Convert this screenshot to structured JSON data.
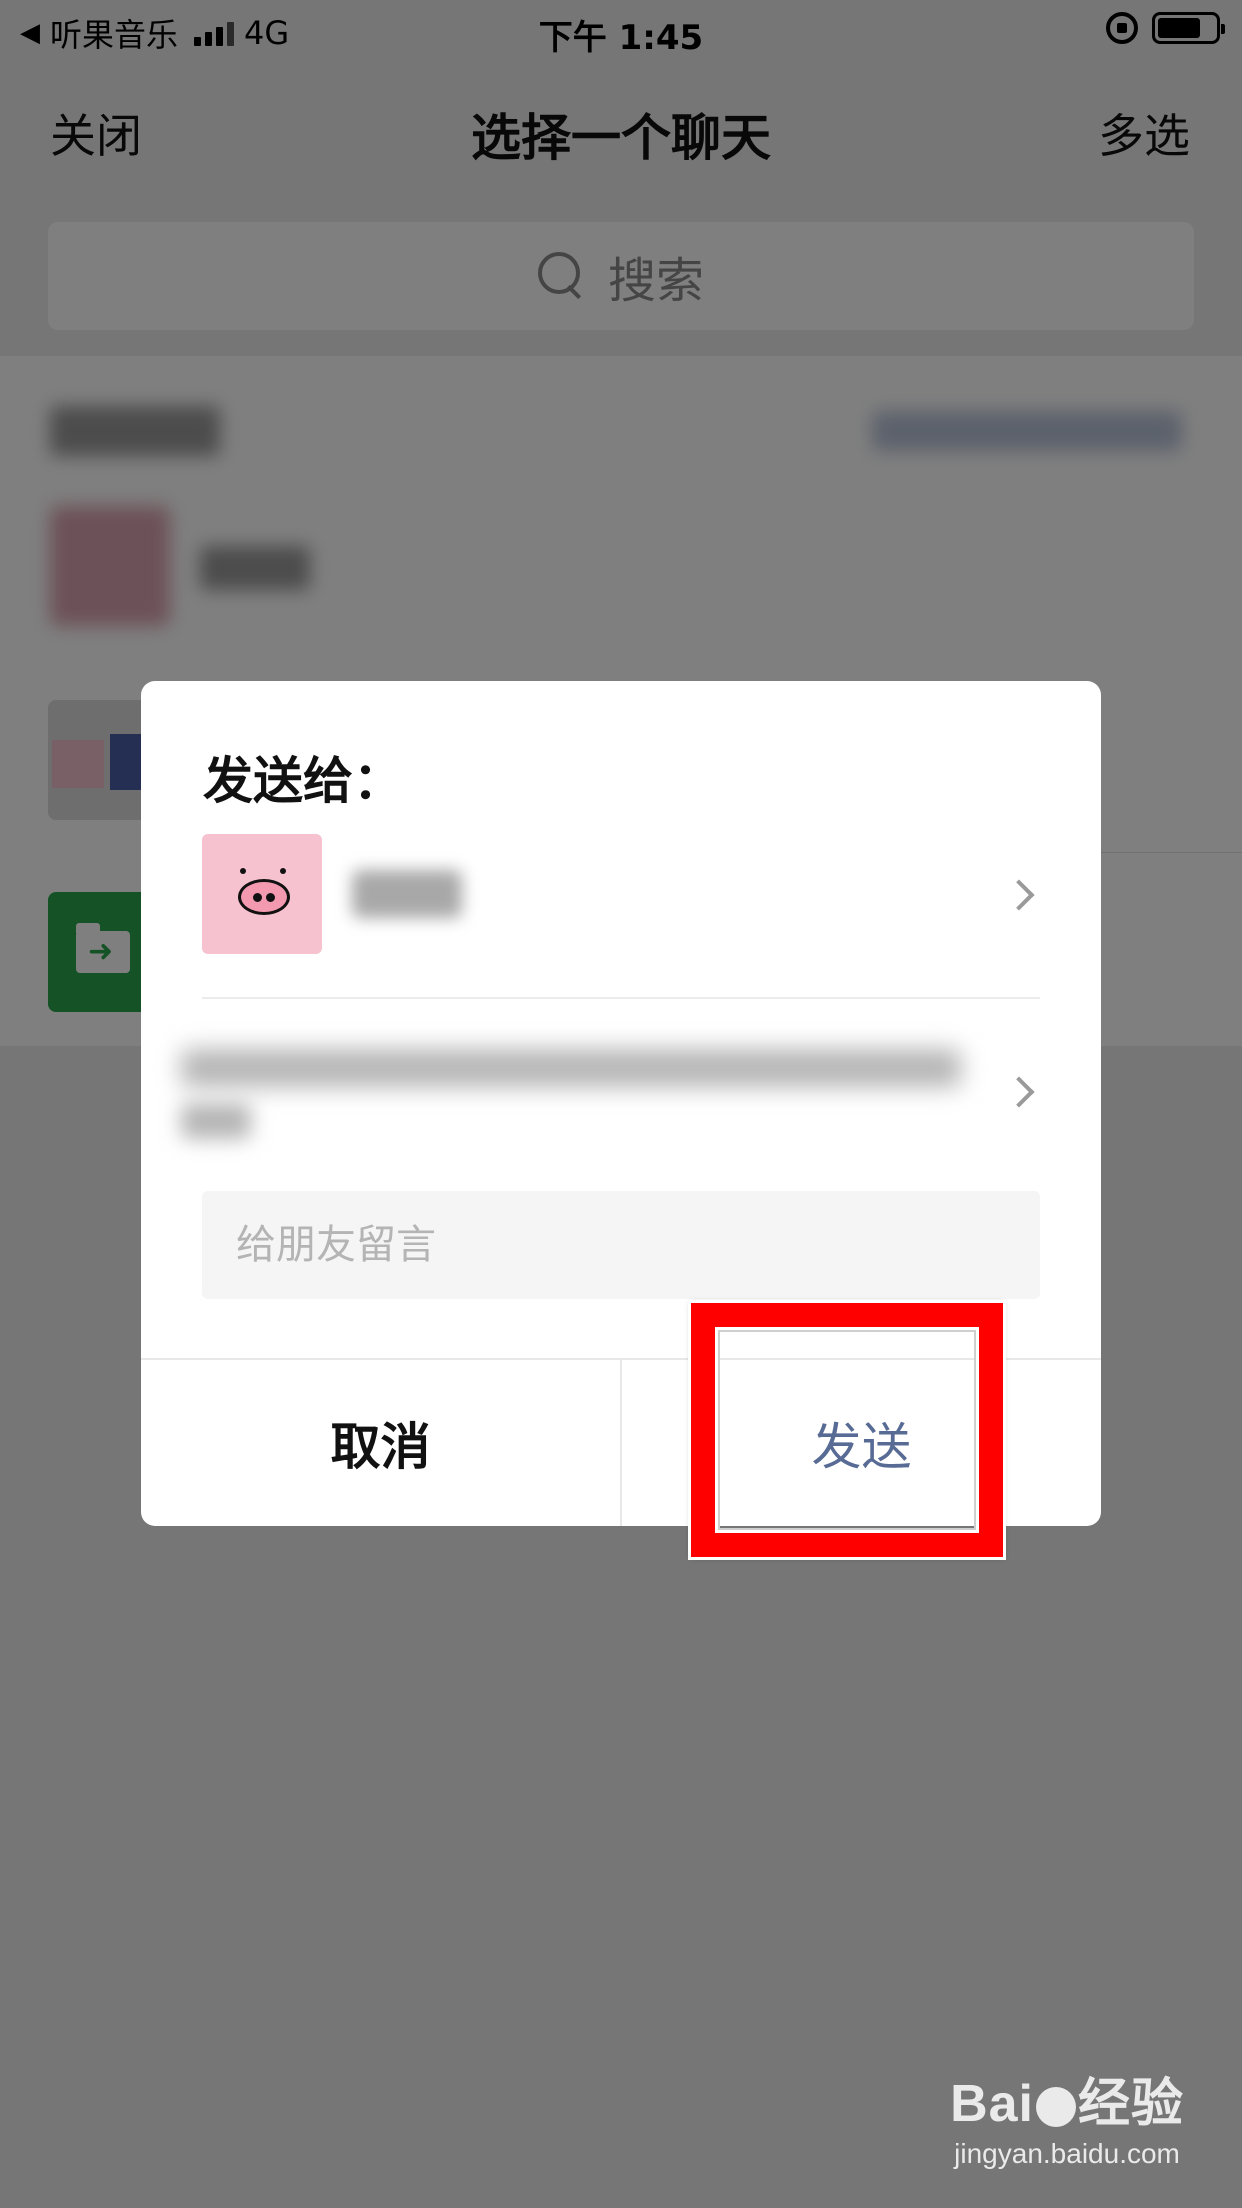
{
  "status_bar": {
    "back_app": "听果音乐",
    "network": "4G",
    "time": "下午 1:45",
    "battery_level": 0.75
  },
  "nav": {
    "close": "关闭",
    "title": "选择一个聊天",
    "multi_select": "多选"
  },
  "search": {
    "placeholder": "搜索"
  },
  "dialog": {
    "title": "发送给：",
    "comment_placeholder": "给朋友留言",
    "cancel": "取消",
    "send": "发送"
  },
  "watermark": {
    "logo_left": "Bai",
    "logo_right": "经验",
    "url": "jingyan.baidu.com"
  },
  "colors": {
    "highlight": "#ff0000",
    "send_text": "#576b95",
    "folder_green": "#2aa54a",
    "pig_pink": "#f6c2cf"
  }
}
